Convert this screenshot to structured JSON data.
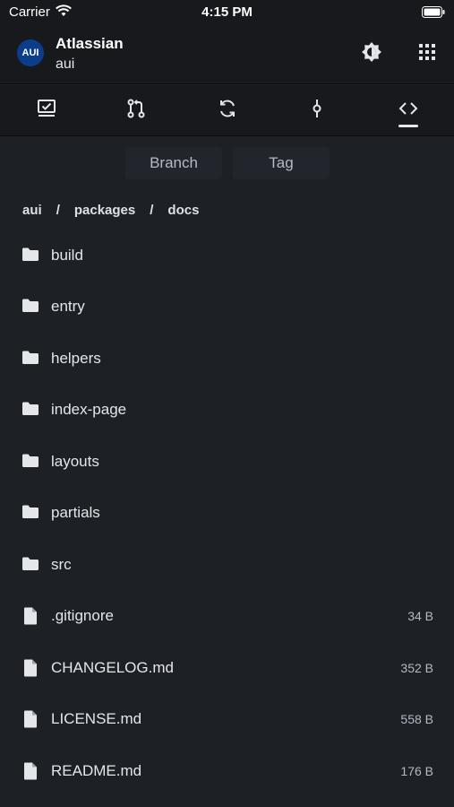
{
  "status": {
    "carrier": "Carrier",
    "time": "4:15 PM"
  },
  "header": {
    "avatar_text": "AUI",
    "workspace": "Atlassian",
    "repo": "aui",
    "accent_color": "#0c3d8a"
  },
  "tabs": [
    {
      "name": "overview",
      "icon": "monitor-check-icon"
    },
    {
      "name": "pull-requests",
      "icon": "pull-request-icon"
    },
    {
      "name": "pipelines",
      "icon": "sync-icon"
    },
    {
      "name": "commits",
      "icon": "commit-icon"
    },
    {
      "name": "source",
      "icon": "code-icon",
      "active": true
    }
  ],
  "segments": {
    "branch_label": "Branch",
    "tag_label": "Tag"
  },
  "breadcrumb": [
    "aui",
    "packages",
    "docs"
  ],
  "breadcrumb_separator": "/",
  "files": [
    {
      "name": "build",
      "type": "folder",
      "size": ""
    },
    {
      "name": "entry",
      "type": "folder",
      "size": ""
    },
    {
      "name": "helpers",
      "type": "folder",
      "size": ""
    },
    {
      "name": "index-page",
      "type": "folder",
      "size": ""
    },
    {
      "name": "layouts",
      "type": "folder",
      "size": ""
    },
    {
      "name": "partials",
      "type": "folder",
      "size": ""
    },
    {
      "name": "src",
      "type": "folder",
      "size": ""
    },
    {
      "name": ".gitignore",
      "type": "file",
      "size": "34 B"
    },
    {
      "name": "CHANGELOG.md",
      "type": "file",
      "size": "352 B"
    },
    {
      "name": "LICENSE.md",
      "type": "file",
      "size": "558 B"
    },
    {
      "name": "README.md",
      "type": "file",
      "size": "176 B"
    }
  ]
}
